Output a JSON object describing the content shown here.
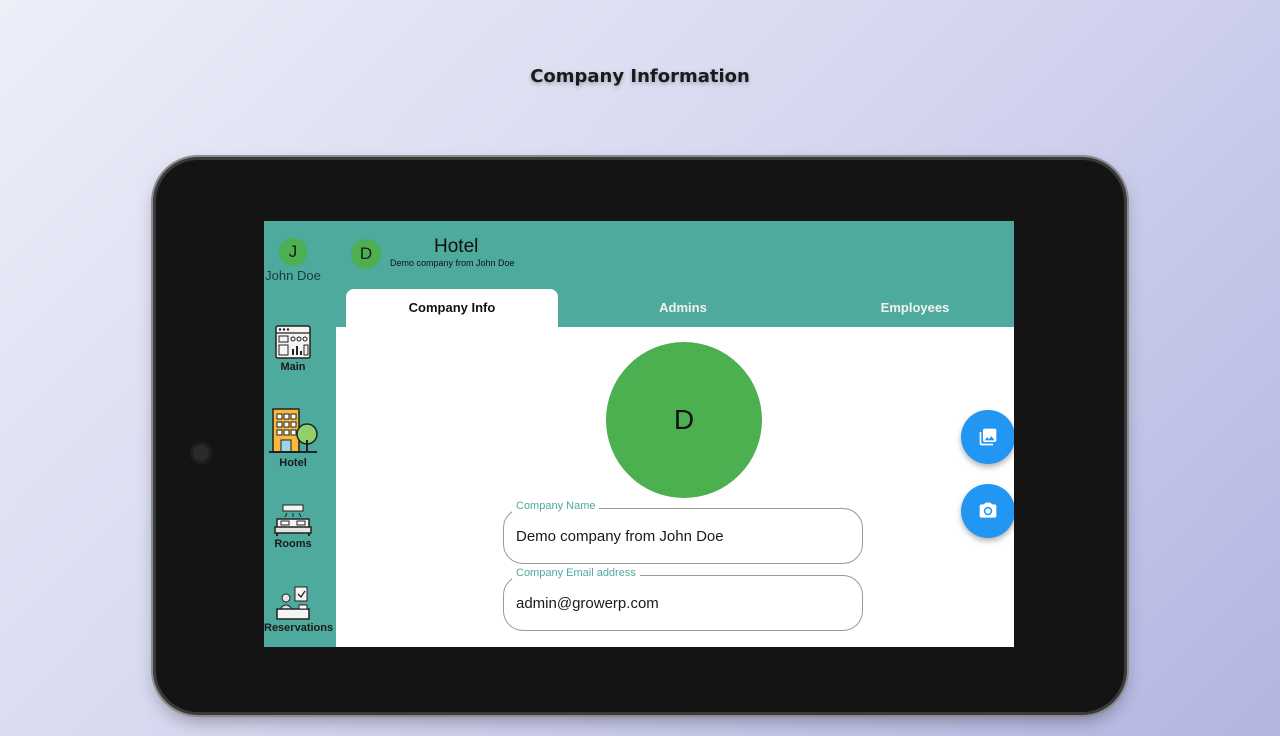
{
  "page": {
    "title": "Company Information"
  },
  "rail": {
    "user_initial": "J",
    "user_name": "John Doe",
    "items": [
      {
        "label": "Main",
        "icon": "dashboard-icon"
      },
      {
        "label": "Hotel",
        "icon": "hotel-building-icon"
      },
      {
        "label": "Rooms",
        "icon": "rooms-bed-icon"
      },
      {
        "label": "Reservations",
        "icon": "reservations-desk-icon"
      }
    ]
  },
  "appbar": {
    "company_initial": "D",
    "title": "Hotel",
    "subtitle": "Demo company from John Doe"
  },
  "tabs": [
    {
      "label": "Company Info",
      "active": true
    },
    {
      "label": "Admins",
      "active": false
    },
    {
      "label": "Employees",
      "active": false
    }
  ],
  "company": {
    "avatar_initial": "D",
    "name_label": "Company Name",
    "name_value": "Demo company from John Doe",
    "email_label": "Company Email address",
    "email_value": "admin@growerp.com"
  },
  "fabs": [
    {
      "icon": "photo-library-icon"
    },
    {
      "icon": "camera-icon"
    }
  ],
  "colors": {
    "primary": "#4eaa9d",
    "avatar": "#4caf50",
    "fab": "#2196f3"
  }
}
